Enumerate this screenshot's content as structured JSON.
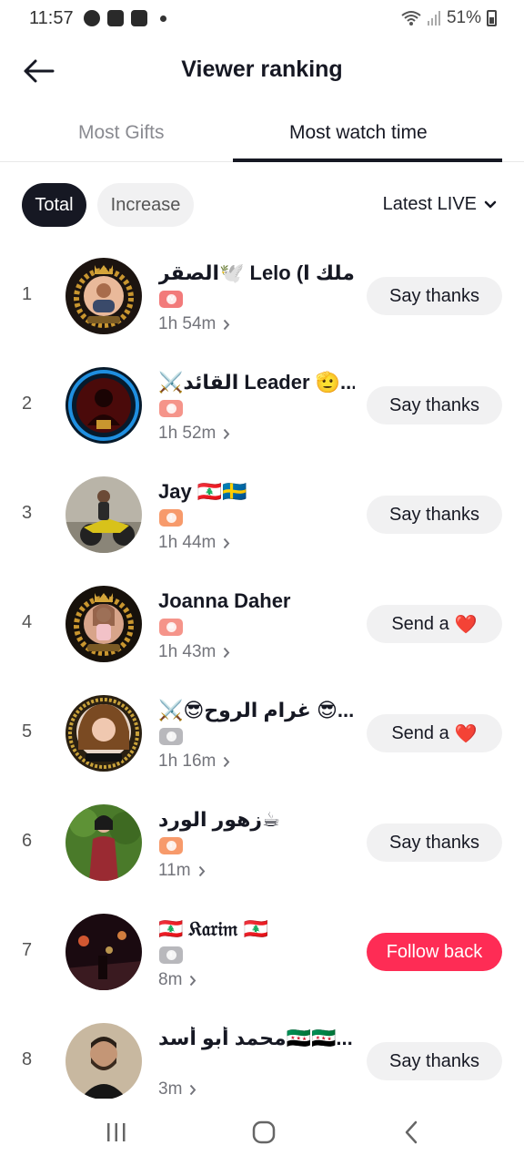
{
  "status": {
    "time": "11:57",
    "battery": "51%"
  },
  "header": {
    "title": "Viewer ranking"
  },
  "tabs": [
    {
      "label": "Most Gifts"
    },
    {
      "label": "Most watch time"
    }
  ],
  "filters": {
    "total": "Total",
    "increase": "Increase",
    "latest": "Latest LIVE"
  },
  "viewers": [
    {
      "rank": "1",
      "name": "الصقر🕊️ Lelo (ملك ا...",
      "badge": "IV",
      "badge_color": "#f27a7a",
      "time": "1h 54m",
      "action": "Say thanks"
    },
    {
      "rank": "2",
      "name": "⚔️القائد Leader 🫡...",
      "badge": "III",
      "badge_color": "#f5948a",
      "time": "1h 52m",
      "action": "Say thanks"
    },
    {
      "rank": "3",
      "name": "Jay 🇱🇧🇸🇪",
      "badge": "I",
      "badge_color": "#f79a6b",
      "time": "1h 44m",
      "action": "Say thanks"
    },
    {
      "rank": "4",
      "name": "Joanna Daher",
      "badge": "III",
      "badge_color": "#f5948a",
      "time": "1h 43m",
      "action": "Send a",
      "heart": "❤️"
    },
    {
      "rank": "5",
      "name": "⚔️😎غرام الروح 😎...",
      "badge": "I",
      "badge_color": "#b8b8bc",
      "time": "1h 16m",
      "action": "Send a",
      "heart": "❤️"
    },
    {
      "rank": "6",
      "name": "زهور الورد☕",
      "badge": "I",
      "badge_color": "#f79a6b",
      "time": "11m",
      "action": "Say thanks"
    },
    {
      "rank": "7",
      "name": "🇱🇧 𝔎𝔞𝔯𝔦𝔪 🇱🇧",
      "badge": "I",
      "badge_color": "#b8b8bc",
      "time": "8m",
      "action": "Follow back",
      "primary": true
    },
    {
      "rank": "8",
      "name": "محمد أبو أسد🇸🇾🇸🇾...",
      "badge": "",
      "badge_color": "",
      "time": "3m",
      "action": "Say thanks"
    }
  ]
}
